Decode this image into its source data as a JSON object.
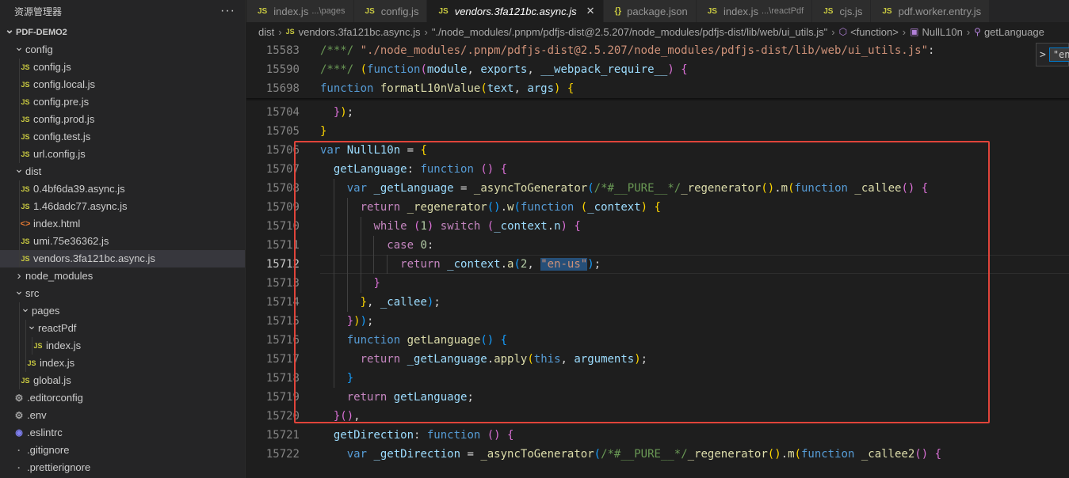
{
  "explorer": {
    "title": "资源管理器",
    "more": "···",
    "tree": [
      {
        "label": "PDF-DEMO2",
        "type": "root",
        "depth": 0,
        "chevron": "v"
      },
      {
        "label": "config",
        "type": "folder",
        "depth": 1,
        "chevron": "v"
      },
      {
        "label": "config.js",
        "type": "js",
        "depth": 2
      },
      {
        "label": "config.local.js",
        "type": "js",
        "depth": 2
      },
      {
        "label": "config.pre.js",
        "type": "js",
        "depth": 2
      },
      {
        "label": "config.prod.js",
        "type": "js",
        "depth": 2
      },
      {
        "label": "config.test.js",
        "type": "js",
        "depth": 2
      },
      {
        "label": "url.config.js",
        "type": "js",
        "depth": 2
      },
      {
        "label": "dist",
        "type": "folder",
        "depth": 1,
        "chevron": "v"
      },
      {
        "label": "0.4bf6da39.async.js",
        "type": "js",
        "depth": 2
      },
      {
        "label": "1.46dadc77.async.js",
        "type": "js",
        "depth": 2
      },
      {
        "label": "index.html",
        "type": "html",
        "depth": 2
      },
      {
        "label": "umi.75e36362.js",
        "type": "js",
        "depth": 2
      },
      {
        "label": "vendors.3fa121bc.async.js",
        "type": "js",
        "depth": 2,
        "selected": true
      },
      {
        "label": "node_modules",
        "type": "folder",
        "depth": 1,
        "chevron": ">"
      },
      {
        "label": "src",
        "type": "folder",
        "depth": 1,
        "chevron": "v"
      },
      {
        "label": "pages",
        "type": "folder",
        "depth": 2,
        "chevron": "v"
      },
      {
        "label": "reactPdf",
        "type": "folder",
        "depth": 3,
        "chevron": "v"
      },
      {
        "label": "index.js",
        "type": "js",
        "depth": 4
      },
      {
        "label": "index.js",
        "type": "js",
        "depth": 3
      },
      {
        "label": "global.js",
        "type": "js",
        "depth": 2
      },
      {
        "label": ".editorconfig",
        "type": "gear",
        "depth": 1
      },
      {
        "label": ".env",
        "type": "gear",
        "depth": 1
      },
      {
        "label": ".eslintrc",
        "type": "eslint",
        "depth": 1
      },
      {
        "label": ".gitignore",
        "type": "dot",
        "depth": 1
      },
      {
        "label": ".prettierignore",
        "type": "dot",
        "depth": 1
      }
    ]
  },
  "tabs": [
    {
      "label": "index.js",
      "desc": "...\\pages",
      "icon": "JS"
    },
    {
      "label": "config.js",
      "desc": "",
      "icon": "JS"
    },
    {
      "label": "vendors.3fa121bc.async.js",
      "desc": "",
      "icon": "JS",
      "active": true,
      "close": "✕"
    },
    {
      "label": "package.json",
      "desc": "",
      "icon": "{}"
    },
    {
      "label": "index.js",
      "desc": "...\\reactPdf",
      "icon": "JS"
    },
    {
      "label": "cjs.js",
      "desc": "",
      "icon": "JS"
    },
    {
      "label": "pdf.worker.entry.js",
      "desc": "",
      "icon": "JS"
    }
  ],
  "breadcrumb": {
    "dist": "dist",
    "file_icon": "JS",
    "file": "vendors.3fa121bc.async.js",
    "module": "\"./node_modules/.pnpm/pdfjs-dist@2.5.207/node_modules/pdfjs-dist/lib/web/ui_utils.js\"",
    "fn": "<function>",
    "obj": "NullL10n",
    "method": "getLanguage"
  },
  "find_widget": {
    "chevron": ">",
    "value": "\"en"
  },
  "editor": {
    "current_line": "15712",
    "sticky_lines": [
      {
        "n": "15583",
        "parts": [
          [
            "cmt",
            "/***/ "
          ],
          [
            "str",
            "\"./node_modules/.pnpm/pdfjs-dist@2.5.207/node_modules/pdfjs-dist/lib/web/ui_utils.js\""
          ],
          [
            "pl",
            ":"
          ]
        ]
      },
      {
        "n": "15590",
        "parts": [
          [
            "cmt",
            "/***/ "
          ],
          [
            "b1",
            "("
          ],
          [
            "kw",
            "function"
          ],
          [
            "b2",
            "("
          ],
          [
            "var",
            "module"
          ],
          [
            "pl",
            ", "
          ],
          [
            "var",
            "exports"
          ],
          [
            "pl",
            ", "
          ],
          [
            "var",
            "__webpack_require__"
          ],
          [
            "b2",
            ")"
          ],
          [
            "pl",
            " "
          ],
          [
            "b2",
            "{"
          ]
        ]
      },
      {
        "n": "15698",
        "parts": [
          [
            "kw",
            "function"
          ],
          [
            "pl",
            " "
          ],
          [
            "fn",
            "formatL10nValue"
          ],
          [
            "b1",
            "("
          ],
          [
            "var",
            "text"
          ],
          [
            "pl",
            ", "
          ],
          [
            "var",
            "args"
          ],
          [
            "b1",
            ")"
          ],
          [
            "pl",
            " "
          ],
          [
            "b1",
            "{"
          ]
        ]
      }
    ],
    "lines": [
      {
        "n": "15704",
        "parts": [
          [
            "pl",
            "  "
          ],
          [
            "b2",
            "}"
          ],
          [
            "b1",
            ")"
          ],
          [
            "pl",
            ";"
          ]
        ]
      },
      {
        "n": "15705",
        "parts": [
          [
            "b1",
            "}"
          ]
        ]
      },
      {
        "n": "15706",
        "parts": [
          [
            "kw",
            "var"
          ],
          [
            "pl",
            " "
          ],
          [
            "var",
            "NullL10n"
          ],
          [
            "pl",
            " = "
          ],
          [
            "b1",
            "{"
          ]
        ]
      },
      {
        "n": "15707",
        "parts": [
          [
            "pl",
            "  "
          ],
          [
            "var",
            "getLanguage"
          ],
          [
            "pl",
            ": "
          ],
          [
            "kw",
            "function"
          ],
          [
            "pl",
            " "
          ],
          [
            "b2",
            "("
          ],
          [
            "b2",
            ")"
          ],
          [
            "pl",
            " "
          ],
          [
            "b2",
            "{"
          ]
        ]
      },
      {
        "n": "15708",
        "parts": [
          [
            "pl",
            "    "
          ],
          [
            "kw",
            "var"
          ],
          [
            "pl",
            " "
          ],
          [
            "var",
            "_getLanguage"
          ],
          [
            "pl",
            " = "
          ],
          [
            "fn",
            "_asyncToGenerator"
          ],
          [
            "b3",
            "("
          ],
          [
            "cmt",
            "/*#__PURE__*/"
          ],
          [
            "fn",
            "_regenerator"
          ],
          [
            "b1",
            "()"
          ],
          [
            "pl",
            "."
          ],
          [
            "fn",
            "m"
          ],
          [
            "b1",
            "("
          ],
          [
            "kw",
            "function"
          ],
          [
            "pl",
            " "
          ],
          [
            "fn",
            "_callee"
          ],
          [
            "b2",
            "()"
          ],
          [
            "pl",
            " "
          ],
          [
            "b2",
            "{"
          ]
        ]
      },
      {
        "n": "15709",
        "parts": [
          [
            "pl",
            "      "
          ],
          [
            "ctl",
            "return"
          ],
          [
            "pl",
            " "
          ],
          [
            "fn",
            "_regenerator"
          ],
          [
            "b3",
            "()"
          ],
          [
            "pl",
            "."
          ],
          [
            "fn",
            "w"
          ],
          [
            "b3",
            "("
          ],
          [
            "kw",
            "function"
          ],
          [
            "pl",
            " "
          ],
          [
            "b1",
            "("
          ],
          [
            "var",
            "_context"
          ],
          [
            "b1",
            ")"
          ],
          [
            "pl",
            " "
          ],
          [
            "b1",
            "{"
          ]
        ]
      },
      {
        "n": "15710",
        "parts": [
          [
            "pl",
            "        "
          ],
          [
            "ctl",
            "while"
          ],
          [
            "pl",
            " "
          ],
          [
            "b2",
            "("
          ],
          [
            "num",
            "1"
          ],
          [
            "b2",
            ")"
          ],
          [
            "pl",
            " "
          ],
          [
            "ctl",
            "switch"
          ],
          [
            "pl",
            " "
          ],
          [
            "b2",
            "("
          ],
          [
            "var",
            "_context"
          ],
          [
            "pl",
            "."
          ],
          [
            "var",
            "n"
          ],
          [
            "b2",
            ")"
          ],
          [
            "pl",
            " "
          ],
          [
            "b2",
            "{"
          ]
        ]
      },
      {
        "n": "15711",
        "parts": [
          [
            "pl",
            "          "
          ],
          [
            "ctl",
            "case"
          ],
          [
            "pl",
            " "
          ],
          [
            "num",
            "0"
          ],
          [
            "pl",
            ":"
          ]
        ]
      },
      {
        "n": "15712",
        "parts": [
          [
            "pl",
            "            "
          ],
          [
            "ctl",
            "return"
          ],
          [
            "pl",
            " "
          ],
          [
            "var",
            "_context"
          ],
          [
            "pl",
            "."
          ],
          [
            "fn",
            "a"
          ],
          [
            "b3",
            "("
          ],
          [
            "num",
            "2"
          ],
          [
            "pl",
            ", "
          ],
          [
            "strsel",
            "\"en-us\""
          ],
          [
            "b3",
            ")"
          ],
          [
            "pl",
            ";"
          ]
        ]
      },
      {
        "n": "15713",
        "parts": [
          [
            "pl",
            "        "
          ],
          [
            "b2",
            "}"
          ]
        ]
      },
      {
        "n": "15714",
        "parts": [
          [
            "pl",
            "      "
          ],
          [
            "b1",
            "}"
          ],
          [
            "pl",
            ", "
          ],
          [
            "var",
            "_callee"
          ],
          [
            "b3",
            ")"
          ],
          [
            "pl",
            ";"
          ]
        ]
      },
      {
        "n": "15715",
        "parts": [
          [
            "pl",
            "    "
          ],
          [
            "b2",
            "}"
          ],
          [
            "b1",
            ")"
          ],
          [
            "b3",
            ")"
          ],
          [
            "pl",
            ";"
          ]
        ]
      },
      {
        "n": "15716",
        "parts": [
          [
            "pl",
            "    "
          ],
          [
            "kw",
            "function"
          ],
          [
            "pl",
            " "
          ],
          [
            "fn",
            "getLanguage"
          ],
          [
            "b3",
            "()"
          ],
          [
            "pl",
            " "
          ],
          [
            "b3",
            "{"
          ]
        ]
      },
      {
        "n": "15717",
        "parts": [
          [
            "pl",
            "      "
          ],
          [
            "ctl",
            "return"
          ],
          [
            "pl",
            " "
          ],
          [
            "var",
            "_getLanguage"
          ],
          [
            "pl",
            "."
          ],
          [
            "fn",
            "apply"
          ],
          [
            "b1",
            "("
          ],
          [
            "kw",
            "this"
          ],
          [
            "pl",
            ", "
          ],
          [
            "var",
            "arguments"
          ],
          [
            "b1",
            ")"
          ],
          [
            "pl",
            ";"
          ]
        ]
      },
      {
        "n": "15718",
        "parts": [
          [
            "pl",
            "    "
          ],
          [
            "b3",
            "}"
          ]
        ]
      },
      {
        "n": "15719",
        "parts": [
          [
            "pl",
            "    "
          ],
          [
            "ctl",
            "return"
          ],
          [
            "pl",
            " "
          ],
          [
            "var",
            "getLanguage"
          ],
          [
            "pl",
            ";"
          ]
        ]
      },
      {
        "n": "15720",
        "parts": [
          [
            "pl",
            "  "
          ],
          [
            "b2",
            "}"
          ],
          [
            "b2",
            "()"
          ],
          [
            "pl",
            ","
          ]
        ]
      },
      {
        "n": "15721",
        "parts": [
          [
            "pl",
            "  "
          ],
          [
            "var",
            "getDirection"
          ],
          [
            "pl",
            ": "
          ],
          [
            "kw",
            "function"
          ],
          [
            "pl",
            " "
          ],
          [
            "b2",
            "()"
          ],
          [
            "pl",
            " "
          ],
          [
            "b2",
            "{"
          ]
        ]
      },
      {
        "n": "15722",
        "parts": [
          [
            "pl",
            "    "
          ],
          [
            "kw",
            "var"
          ],
          [
            "pl",
            " "
          ],
          [
            "var",
            "_getDirection"
          ],
          [
            "pl",
            " = "
          ],
          [
            "fn",
            "_asyncToGenerator"
          ],
          [
            "b3",
            "("
          ],
          [
            "cmt",
            "/*#__PURE__*/"
          ],
          [
            "fn",
            "_regenerator"
          ],
          [
            "b1",
            "()"
          ],
          [
            "pl",
            "."
          ],
          [
            "fn",
            "m"
          ],
          [
            "b1",
            "("
          ],
          [
            "kw",
            "function"
          ],
          [
            "pl",
            " "
          ],
          [
            "fn",
            "_callee2"
          ],
          [
            "b2",
            "()"
          ],
          [
            "pl",
            " "
          ],
          [
            "b2",
            "{"
          ]
        ]
      }
    ]
  }
}
